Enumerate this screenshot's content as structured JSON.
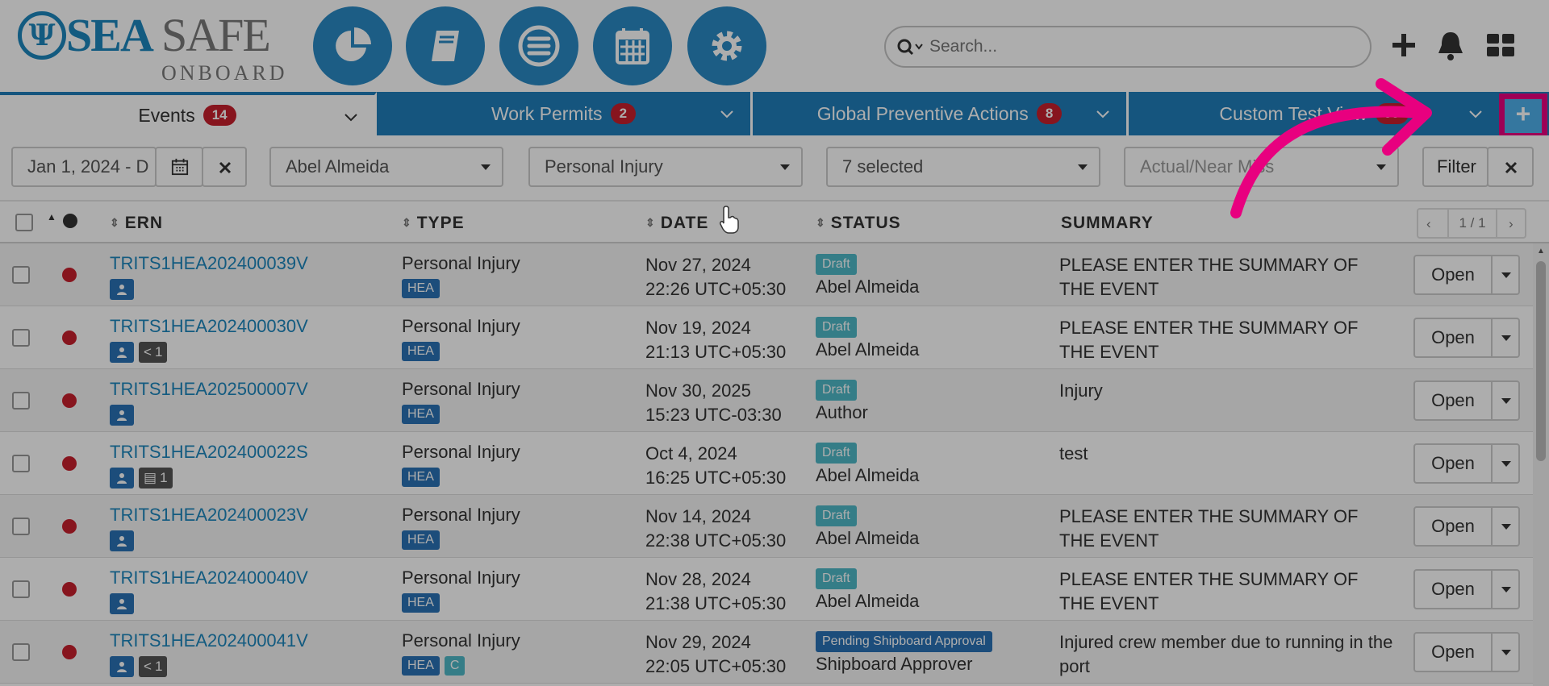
{
  "app": {
    "logo_sea": "SEA",
    "logo_safe": "SAFE",
    "logo_sub": "ONBOARD"
  },
  "nav_icons": [
    "pie-chart-icon",
    "book-icon",
    "menu-icon",
    "calendar-icon",
    "gear-icon"
  ],
  "search": {
    "placeholder": "Search..."
  },
  "tabs": [
    {
      "label": "Events",
      "count": "14"
    },
    {
      "label": "Work Permits",
      "count": "2"
    },
    {
      "label": "Global Preventive Actions",
      "count": "8"
    },
    {
      "label": "Custom Test View",
      "count": "99"
    }
  ],
  "filters": {
    "date_range": "Jan 1, 2024 - D",
    "person": "Abel Almeida",
    "type": "Personal Injury",
    "status": "7 selected",
    "actual_placeholder": "Actual/Near Miss",
    "filter_label": "Filter"
  },
  "table": {
    "headers": {
      "ern": "ERN",
      "type": "TYPE",
      "date": "DATE",
      "status": "STATUS",
      "summary": "SUMMARY"
    },
    "pager": "1 / 1",
    "open_label": "Open",
    "rows": [
      {
        "ern": "TRITS1HEA202400039V",
        "extra": "",
        "type": "Personal Injury",
        "tags": [
          "HEA"
        ],
        "date": "Nov 27, 2024",
        "time": "22:26 UTC+05:30",
        "status": "Draft",
        "who": "Abel Almeida",
        "summary": "PLEASE ENTER THE SUMMARY OF THE EVENT"
      },
      {
        "ern": "TRITS1HEA202400030V",
        "extra": "share-1",
        "type": "Personal Injury",
        "tags": [
          "HEA"
        ],
        "date": "Nov 19, 2024",
        "time": "21:13 UTC+05:30",
        "status": "Draft",
        "who": "Abel Almeida",
        "summary": "PLEASE ENTER THE SUMMARY OF THE EVENT"
      },
      {
        "ern": "TRITS1HEA202500007V",
        "extra": "",
        "type": "Personal Injury",
        "tags": [
          "HEA"
        ],
        "date": "Nov 30, 2025",
        "time": "15:23 UTC-03:30",
        "status": "Draft",
        "who": "Author",
        "summary": "Injury"
      },
      {
        "ern": "TRITS1HEA202400022S",
        "extra": "doc-1",
        "type": "Personal Injury",
        "tags": [
          "HEA"
        ],
        "date": "Oct 4, 2024",
        "time": "16:25 UTC+05:30",
        "status": "Draft",
        "who": "Abel Almeida",
        "summary": "test"
      },
      {
        "ern": "TRITS1HEA202400023V",
        "extra": "",
        "type": "Personal Injury",
        "tags": [
          "HEA"
        ],
        "date": "Nov 14, 2024",
        "time": "22:38 UTC+05:30",
        "status": "Draft",
        "who": "Abel Almeida",
        "summary": "PLEASE ENTER THE SUMMARY OF THE EVENT"
      },
      {
        "ern": "TRITS1HEA202400040V",
        "extra": "",
        "type": "Personal Injury",
        "tags": [
          "HEA"
        ],
        "date": "Nov 28, 2024",
        "time": "21:38 UTC+05:30",
        "status": "Draft",
        "who": "Abel Almeida",
        "summary": "PLEASE ENTER THE SUMMARY OF THE EVENT"
      },
      {
        "ern": "TRITS1HEA202400041V",
        "extra": "share-1",
        "type": "Personal Injury",
        "tags": [
          "HEA",
          "C"
        ],
        "date": "Nov 29, 2024",
        "time": "22:05 UTC+05:30",
        "status": "Pending Shipboard Approval",
        "who": "Shipboard Approver",
        "summary": "Injured crew member due to running in the port"
      }
    ]
  },
  "colors": {
    "brand": "#2a8ac4",
    "tabbar": "#1f7eba",
    "danger": "#c8202d",
    "draft": "#4fb8c8",
    "highlight": "#e8007f"
  }
}
